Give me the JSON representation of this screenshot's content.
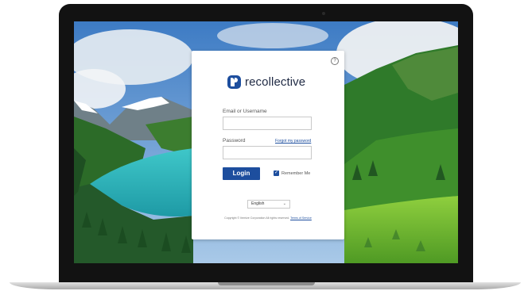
{
  "login": {
    "brand": "recollective",
    "help_icon": "question-circle-icon",
    "help_symbol": "?",
    "email_label": "Email or Username",
    "email_value": "",
    "password_label": "Password",
    "password_value": "",
    "forgot_link": "Forgot my password",
    "login_button": "Login",
    "remember_label": "Remember Me",
    "remember_checked": true,
    "checkmark": "✓",
    "language": "English",
    "language_chevron": "⌄",
    "copyright": "Copyright © Itemize Corporation All rights reserved.",
    "terms_link": "Terms of Service"
  },
  "colors": {
    "brand_blue": "#1d4e9e",
    "card_bg": "#ffffff",
    "bezel": "#121212"
  }
}
